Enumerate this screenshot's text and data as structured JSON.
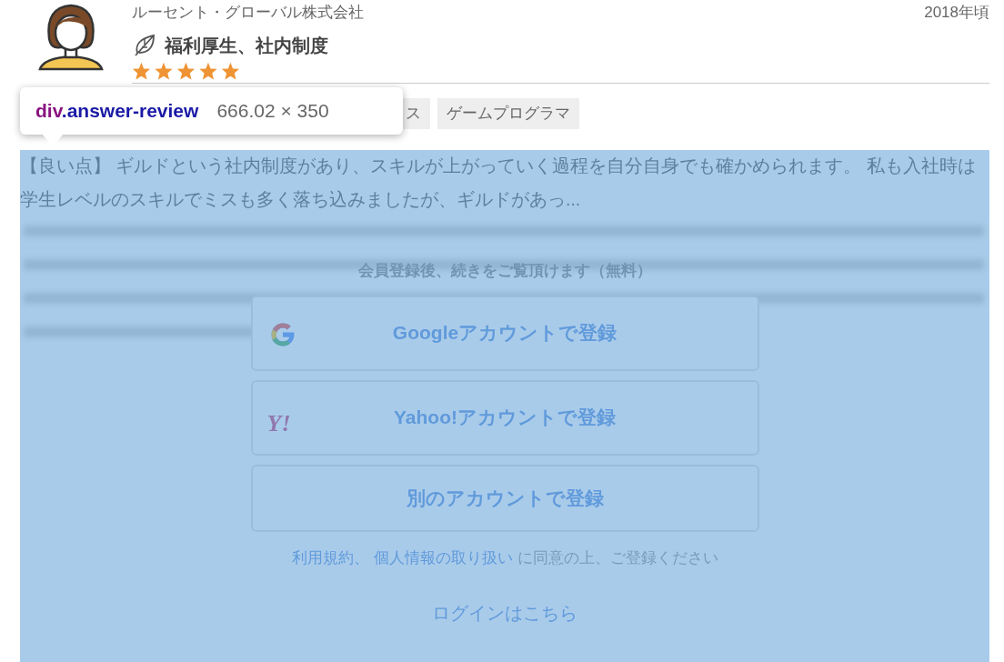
{
  "review": {
    "company": "ルーセント・グローバル株式会社",
    "year": "2018年頃",
    "category": "福利厚生、社内制度",
    "stars": 5,
    "tags": [
      {
        "label": "ス"
      },
      {
        "label": "ゲームプログラマ"
      }
    ],
    "excerpt": "【良い点】 ギルドという社内制度があり、スキルが上がっていく過程を自分自身でも確かめられます。 私も入社時は学生レベルのスキルでミスも多く落ち込みましたが、ギルドがあっ..."
  },
  "signup": {
    "heading": "会員登録後、続きをご覧頂けます（無料）",
    "buttons": [
      {
        "kind": "google",
        "label": "Googleアカウントで登録"
      },
      {
        "kind": "yahoo",
        "label": "Yahoo!アカウントで登録",
        "logo": "Y!"
      },
      {
        "kind": "other",
        "label": "別のアカウントで登録"
      }
    ],
    "terms_links": [
      "利用規約、",
      "個人情報の取り扱い"
    ],
    "terms_text": "に同意の上、ご登録ください",
    "login_link": "ログインはこちら"
  },
  "inspector_tooltip": {
    "tag": "div",
    "class_name": ".answer-review",
    "size": "666.02 × 350"
  }
}
